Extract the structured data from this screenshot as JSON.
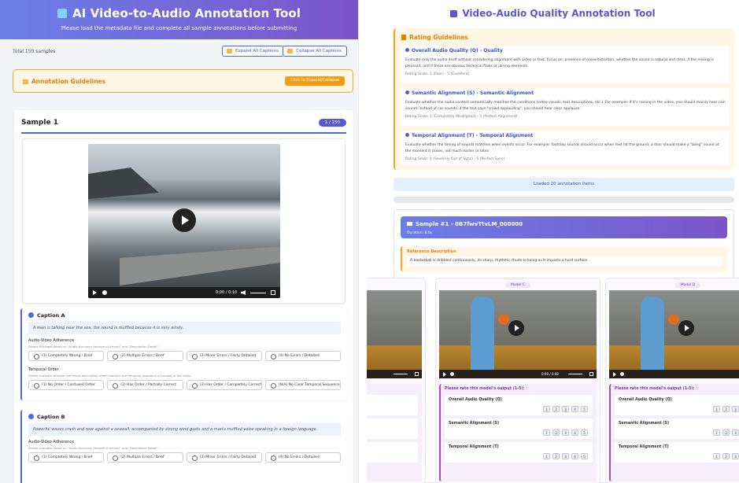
{
  "left": {
    "header": {
      "title": "AI Video-to-Audio Annotation Tool",
      "subtitle": "Please load the metadata file and complete all sample annotations before submitting"
    },
    "toolbar": {
      "total_text": "Total 150 samples",
      "expand_label": "Expand All Captions",
      "collapse_label": "Collapse All Captions"
    },
    "guidelines": {
      "title": "Annotation Guidelines",
      "button_label": "Click to Expand/Collapse"
    },
    "sample": {
      "title": "Sample 1",
      "badge": "1 / 150",
      "video_time": "0:00 / 0:10",
      "caption_a": {
        "title": "Caption A",
        "text": "A man is talking near the sea, the sound is muffled because it is very windy.",
        "criteria1": {
          "name": "Audio-Video Adherence",
          "hint": "Please evaluate based on \"Audio Accuracy (degree of errors)\" and \"Description Detail\".",
          "options": [
            "(1) Completely Wrong / Brief",
            "(2) Multiple Errors / Brief",
            "(3) Minor Errors / Fairly Detailed",
            "(4) No Errors / Detailed"
          ]
        },
        "criteria2": {
          "name": "Temporal Order",
          "hint": "Please evaluate whether the event description order matches the temporal sequence of sounds in the video.",
          "options": [
            "(1) No Order / Confused Order",
            "(2) Has Order / Partially Correct",
            "(3) Has Order / Completely Correct",
            "(N/A) No Clear Temporal Sequence"
          ]
        }
      },
      "caption_b": {
        "title": "Caption B",
        "text": "Powerful waves crash and roar against a seawall, accompanied by strong wind gusts and a man's muffled voice speaking in a foreign language.",
        "criteria1": {
          "name": "Audio-Video Adherence",
          "hint": "Please evaluate based on \"Audio Accuracy (degree of errors)\" and \"Description Detail\".",
          "options": [
            "(1) Completely Wrong / Brief",
            "(2) Multiple Errors / Brief",
            "(3) Minor Errors / Fairly Detailed",
            "(4) No Errors / Detailed"
          ]
        }
      }
    }
  },
  "right": {
    "title": "Video-Audio Quality Annotation Tool",
    "rating_guidelines": {
      "title": "Rating Guidelines",
      "items": [
        {
          "title": "Overall Audio Quality (Q) - Quality",
          "desc": "Evaluate only the audio itself without considering alignment with video or text. Focus on: presence of noise/distortion, whether the sound is natural and clear, if the mixing is pleasant, and if there are obvious technical flaws or jarring elements.",
          "scale": "Rating Scale: 1 (Poor) - 5 (Excellent)"
        },
        {
          "title": "Semantic Alignment (S) - Semantic Alignment",
          "desc": "Evaluate whether the audio content semantically matches the conditions (video visuals, text descriptions, etc.). For example: If it's raining in the video, you should mainly hear rain sounds instead of car sounds; if the text says \"crowd applauding\", you should hear clear applause.",
          "scale": "Rating Scale: 1 (Completely Misaligned) - 5 (Perfect Alignment)"
        },
        {
          "title": "Temporal Alignment (T) - Temporal Alignment",
          "desc": "Evaluate whether the timing of sounds matches when events occur. For example: footstep sounds should occur when feet hit the ground, a door should make a \"bang\" sound at the moment it closes, not much earlier or later.",
          "scale": "Rating Scale: 1 (Severely Out of Sync) - 5 (Perfect Sync)"
        }
      ]
    },
    "loaded_text": "Loaded 20 annotation items",
    "sample": {
      "title": "Sample #1 - 0B7fwvTtvLM_000000",
      "duration": "Duration: 8.0s",
      "reference": {
        "label": "Reference Description",
        "text": "A basketball is dribbled continuously, its sharp, rhythmic thuds echoing as it impacts a hard surface."
      },
      "models": [
        {
          "name": "",
          "time": "",
          "criteria": [
            "",
            "",
            ""
          ]
        },
        {
          "name": "Model C",
          "time": "0:00 / 0:08",
          "criteria": [
            "Overall Audio Quality (Q)",
            "Semantic Alignment (S)",
            "Temporal Alignment (T)"
          ]
        },
        {
          "name": "Model D",
          "time": "",
          "criteria": [
            "Overall Audio Quality (Q)",
            "Semantic Alignment (S)",
            "Temporal Alignment (T)"
          ]
        }
      ],
      "rate_prompt": "Please rate this model's output (1-5):",
      "scores": [
        "1",
        "2",
        "3",
        "4",
        "5"
      ]
    }
  }
}
